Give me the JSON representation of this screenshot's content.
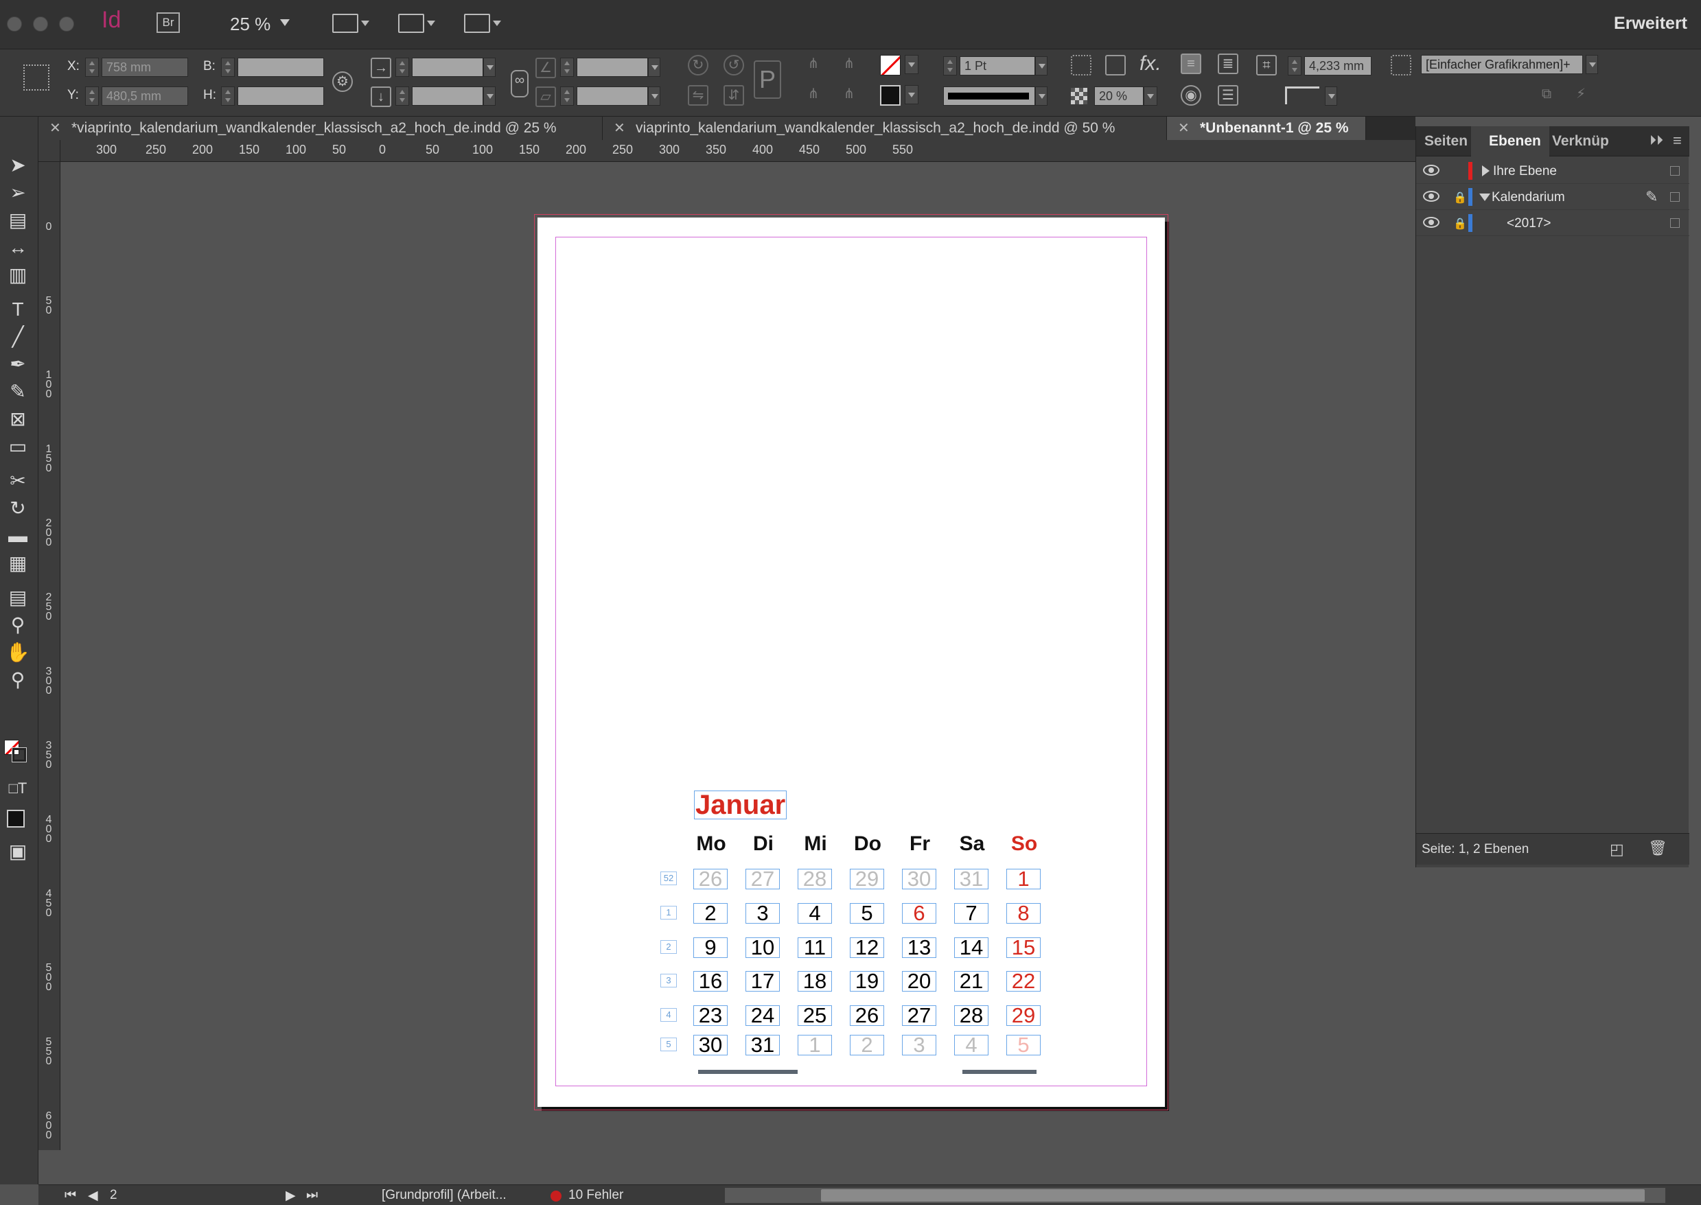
{
  "app": {
    "logo_id": "Id",
    "logo_br": "Br",
    "zoom": "25 %",
    "workspace": "Erweitert"
  },
  "control": {
    "x_label": "X:",
    "y_label": "Y:",
    "b_label": "B:",
    "h_label": "H:",
    "x_value": "758 mm",
    "y_value": "480,5 mm",
    "stroke_weight": "1 Pt",
    "opacity": "20 %",
    "offset": "4,233 mm",
    "frame_style": "[Einfacher Grafikrahmen]+"
  },
  "tabs": [
    {
      "label": "*viaprinto_kalendarium_wandkalender_klassisch_a2_hoch_de.indd @ 25 %",
      "active": false
    },
    {
      "label": "viaprinto_kalendarium_wandkalender_klassisch_a2_hoch_de.indd @ 50 %",
      "active": false
    },
    {
      "label": "*Unbenannt-1 @ 25 %",
      "active": true
    }
  ],
  "ruler": {
    "h_labels": [
      "300",
      "250",
      "200",
      "150",
      "100",
      "50",
      "0",
      "50",
      "100",
      "150",
      "200",
      "250",
      "300",
      "350",
      "400",
      "450",
      "500",
      "550"
    ],
    "v_labels": [
      "0",
      "50",
      "100",
      "150",
      "200",
      "250",
      "300",
      "350",
      "400",
      "450",
      "500",
      "550",
      "600"
    ]
  },
  "calendar": {
    "month": "Januar",
    "weekdays": [
      "Mo",
      "Di",
      "Mi",
      "Do",
      "Fr",
      "Sa",
      "So"
    ],
    "weeks": [
      {
        "kw": "52",
        "days": [
          "26",
          "27",
          "28",
          "29",
          "30",
          "31",
          "1"
        ],
        "types": [
          "other",
          "other",
          "other",
          "other",
          "other",
          "other",
          "sun"
        ]
      },
      {
        "kw": "1",
        "days": [
          "2",
          "3",
          "4",
          "5",
          "6",
          "7",
          "8"
        ],
        "types": [
          "n",
          "n",
          "n",
          "n",
          "sun",
          "n",
          "sun"
        ]
      },
      {
        "kw": "2",
        "days": [
          "9",
          "10",
          "11",
          "12",
          "13",
          "14",
          "15"
        ],
        "types": [
          "n",
          "n",
          "n",
          "n",
          "n",
          "n",
          "sun"
        ]
      },
      {
        "kw": "3",
        "days": [
          "16",
          "17",
          "18",
          "19",
          "20",
          "21",
          "22"
        ],
        "types": [
          "n",
          "n",
          "n",
          "n",
          "n",
          "n",
          "sun"
        ]
      },
      {
        "kw": "4",
        "days": [
          "23",
          "24",
          "25",
          "26",
          "27",
          "28",
          "29"
        ],
        "types": [
          "n",
          "n",
          "n",
          "n",
          "n",
          "n",
          "sun"
        ]
      },
      {
        "kw": "5",
        "days": [
          "30",
          "31",
          "1",
          "2",
          "3",
          "4",
          "5"
        ],
        "types": [
          "n",
          "n",
          "other",
          "other",
          "other",
          "other",
          "other-sun"
        ]
      }
    ]
  },
  "layers_panel": {
    "tabs": [
      "Seiten",
      "Ebenen",
      "Verknüp"
    ],
    "layers": [
      {
        "name": "Ihre Ebene",
        "color": "#e02020"
      },
      {
        "name": "Kalendarium",
        "color": "#3a7bd5"
      },
      {
        "name": "<2017>",
        "color": "#3a7bd5"
      }
    ],
    "footer": "Seite: 1, 2 Ebenen"
  },
  "status": {
    "page": "2",
    "profile": "[Grundprofil] (Arbeit...",
    "errors": "10 Fehler"
  },
  "colors": {
    "accent_red": "#d62a1f",
    "frame_blue": "#6aa6e8",
    "margin_magenta": "#d36bd8"
  }
}
